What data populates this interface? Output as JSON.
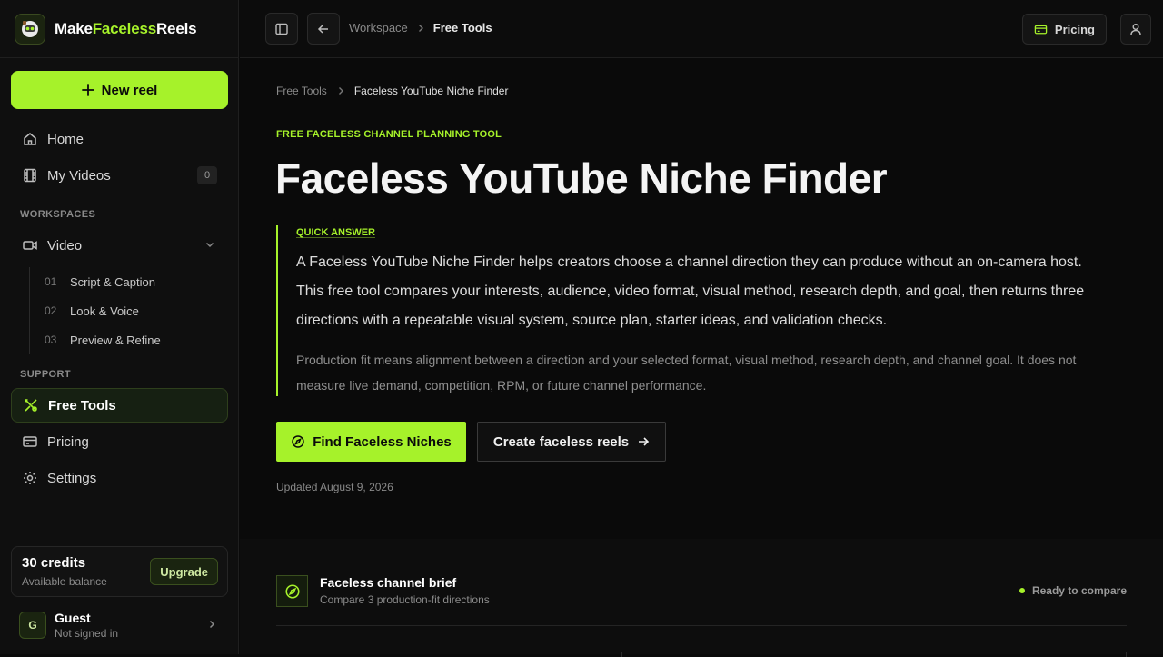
{
  "brand": {
    "part1": "Make",
    "part2": "Faceless",
    "part3": "Reels"
  },
  "sidebar": {
    "new_reel": "New reel",
    "home": "Home",
    "my_videos": "My Videos",
    "my_videos_count": "0",
    "workspaces_label": "WORKSPACES",
    "video": "Video",
    "sub_items": [
      {
        "num": "01",
        "label": "Script & Caption"
      },
      {
        "num": "02",
        "label": "Look & Voice"
      },
      {
        "num": "03",
        "label": "Preview & Refine"
      }
    ],
    "support_label": "SUPPORT",
    "free_tools": "Free Tools",
    "pricing": "Pricing",
    "settings": "Settings",
    "credits_title": "30 credits",
    "credits_sub": "Available balance",
    "upgrade": "Upgrade",
    "guest_initial": "G",
    "guest_name": "Guest",
    "guest_sub": "Not signed in"
  },
  "topbar": {
    "crumb_workspace": "Workspace",
    "crumb_current": "Free Tools",
    "pricing": "Pricing"
  },
  "main": {
    "crumb_parent": "Free Tools",
    "crumb_current": "Faceless YouTube Niche Finder",
    "eyebrow": "FREE FACELESS CHANNEL PLANNING TOOL",
    "title": "Faceless YouTube Niche Finder",
    "answer_label": "QUICK ANSWER",
    "answer_text": "A Faceless YouTube Niche Finder helps creators choose a channel direction they can produce without an on-camera host. This free tool compares your interests, audience, video format, visual method, research depth, and goal, then returns three directions with a repeatable visual system, source plan, starter ideas, and validation checks.",
    "answer_note": "Production fit means alignment between a direction and your selected format, visual method, research depth, and channel goal. It does not measure live demand, competition, RPM, or future channel performance.",
    "cta_primary": "Find Faceless Niches",
    "cta_secondary": "Create faceless reels",
    "updated": "Updated August 9, 2026",
    "brief_title": "Faceless channel brief",
    "brief_sub": "Compare 3 production-fit directions",
    "brief_status": "Ready to compare"
  },
  "colors": {
    "accent": "#a6f22a",
    "background": "#0a0a0a",
    "sidebar": "#0f0f0f"
  }
}
